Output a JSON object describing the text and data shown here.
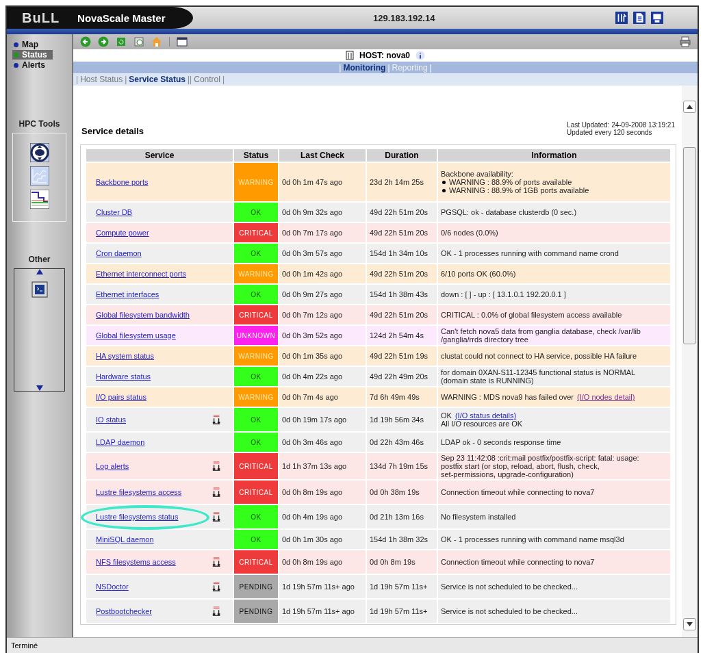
{
  "titlebar": {
    "logo": "BuLL",
    "app": "NovaScale Master",
    "address": "129.183.192.14"
  },
  "nav": [
    {
      "label": "Map",
      "selected": false
    },
    {
      "label": "Status",
      "selected": true
    },
    {
      "label": "Alerts",
      "selected": false
    }
  ],
  "sidebar": {
    "hpc_title": "HPC Tools",
    "other_title": "Other"
  },
  "host": {
    "label": "HOST: nova0"
  },
  "tabs": [
    {
      "kind": "separator",
      "label": "|"
    },
    {
      "kind": "tab",
      "label": "Monitoring",
      "selected": true
    },
    {
      "kind": "separator",
      "label": "|"
    },
    {
      "kind": "tab",
      "label": "Reporting",
      "selected": false
    },
    {
      "kind": "separator",
      "label": "|"
    }
  ],
  "subtabs": [
    {
      "kind": "separator",
      "label": "|"
    },
    {
      "kind": "tab",
      "label": "Host Status",
      "selected": false
    },
    {
      "kind": "separator",
      "label": "|"
    },
    {
      "kind": "tab",
      "label": "Service Status",
      "selected": true
    },
    {
      "kind": "separator",
      "label": "||"
    },
    {
      "kind": "tab",
      "label": "Control",
      "selected": false
    },
    {
      "kind": "separator",
      "label": "|"
    }
  ],
  "details": {
    "title": "Service details",
    "updated": "Last Updated: 24-09-2008 13:19:21",
    "interval": "Updated every 120 seconds"
  },
  "table": {
    "columns": [
      "Service",
      "Status",
      "Last Check",
      "Duration",
      "Information"
    ],
    "rows": [
      {
        "service": "Backbone ports",
        "easy": false,
        "highlighted": false,
        "kind": "warning",
        "status": "WARNING",
        "last_check": "0d 0h 1m 47s ago",
        "duration": "23d 2h 14m 25s",
        "info": [
          {
            "kind": "plain",
            "text": "Backbone availability:"
          },
          {
            "kind": "bullet",
            "text": "WARNING : 88.9% of ports available"
          },
          {
            "kind": "bullet",
            "text": "WARNING : 88.9% of 1GB ports available"
          }
        ]
      },
      {
        "service": "Cluster DB",
        "easy": false,
        "highlighted": false,
        "kind": "ok",
        "status": "OK",
        "last_check": "0d 0h 9m 32s ago",
        "duration": "49d 22h 51m 20s",
        "info": [
          {
            "kind": "plain",
            "text": "PGSQL: ok - database clusterdb (0 sec.)"
          }
        ]
      },
      {
        "service": "Compute power",
        "easy": false,
        "highlighted": false,
        "kind": "critical",
        "status": "CRITICAL",
        "last_check": "0d 0h 7m 17s ago",
        "duration": "49d 22h 51m 20s",
        "info": [
          {
            "kind": "plain",
            "text": "0/6 nodes (0.0%)"
          }
        ]
      },
      {
        "service": "Cron daemon",
        "easy": false,
        "highlighted": false,
        "kind": "ok",
        "status": "OK",
        "last_check": "0d 0h 3m 57s ago",
        "duration": "154d 1h 34m 10s",
        "info": [
          {
            "kind": "plain",
            "text": "OK - 1 processes running with command name crond"
          }
        ]
      },
      {
        "service": "Ethernet interconnect ports",
        "easy": false,
        "highlighted": false,
        "kind": "warning",
        "status": "WARNING",
        "last_check": "0d 0h 1m 42s ago",
        "duration": "49d 22h 51m 20s",
        "info": [
          {
            "kind": "plain",
            "text": "6/10 ports OK (60.0%)"
          }
        ]
      },
      {
        "service": "Ethernet interfaces",
        "easy": false,
        "highlighted": false,
        "kind": "ok",
        "status": "OK",
        "last_check": "0d 0h 9m 27s ago",
        "duration": "154d 1h 38m 43s",
        "info": [
          {
            "kind": "plain",
            "text": "down : [ ] - up : [ 13.1.0.1 192.20.0.1 ]"
          }
        ]
      },
      {
        "service": "Global filesystem bandwidth",
        "easy": false,
        "highlighted": false,
        "kind": "critical",
        "status": "CRITICAL",
        "last_check": "0d 0h 7m 12s ago",
        "duration": "49d 22h 51m 20s",
        "info": [
          {
            "kind": "plain",
            "text": "CRITICAL : 0.0% of global filesystem access available"
          }
        ]
      },
      {
        "service": "Global filesystem usage",
        "easy": false,
        "highlighted": false,
        "kind": "unknown",
        "status": "UNKNOWN",
        "last_check": "0d 0h 3m 52s ago",
        "duration": "124d 2h 54m 4s",
        "info": [
          {
            "kind": "plain",
            "text": "Can't fetch nova5 data from ganglia database, check /var/lib"
          },
          {
            "kind": "plain",
            "text": "/ganglia/rrds directory tree"
          }
        ]
      },
      {
        "service": "HA system status",
        "easy": false,
        "highlighted": false,
        "kind": "warning",
        "status": "WARNING",
        "last_check": "0d 0h 1m 35s ago",
        "duration": "49d 22h 51m 19s",
        "info": [
          {
            "kind": "plain",
            "text": "clustat could not connect to HA service, possible HA failure"
          }
        ]
      },
      {
        "service": "Hardware status",
        "easy": false,
        "highlighted": false,
        "kind": "ok",
        "status": "OK",
        "last_check": "0d 0h 4m 22s ago",
        "duration": "49d 22h 49m 20s",
        "info": [
          {
            "kind": "plain",
            "text": "for domain 0XAN-S11-12345 functional status is NORMAL"
          },
          {
            "kind": "plain",
            "text": "(domain state is RUNNING)"
          }
        ]
      },
      {
        "service": "I/O pairs status",
        "easy": false,
        "highlighted": false,
        "kind": "warning",
        "status": "WARNING",
        "last_check": "0d 0h 7m 4s ago",
        "duration": "7d 6h 49m 49s",
        "info": [
          {
            "kind": "plain",
            "text": "WARNING : MDS nova9 has failed over",
            "link": {
              "text": "(I/O nodes detail)",
              "visited": true
            }
          }
        ]
      },
      {
        "service": "IO status",
        "easy": true,
        "highlighted": false,
        "kind": "ok",
        "status": "OK",
        "last_check": "0d 0h 19m 17s ago",
        "duration": "1d 19h 56m 34s",
        "info": [
          {
            "kind": "plain",
            "text": "OK",
            "link": {
              "text": "(I/O status details)",
              "visited": false
            }
          },
          {
            "kind": "plain",
            "text": "All I/O resources are OK"
          }
        ]
      },
      {
        "service": "LDAP daemon",
        "easy": false,
        "highlighted": false,
        "kind": "ok",
        "status": "OK",
        "last_check": "0d 0h 3m 46s ago",
        "duration": "0d 22h 43m 46s",
        "info": [
          {
            "kind": "plain",
            "text": "LDAP ok - 0 seconds response time"
          }
        ]
      },
      {
        "service": "Log alerts",
        "easy": true,
        "highlighted": false,
        "kind": "critical",
        "status": "CRITICAL",
        "last_check": "1d 1h 37m 13s ago",
        "duration": "134d 7h 19m 15s",
        "info": [
          {
            "kind": "plain",
            "text": "Sep 23 11:42:08 :crit:mail postfix/postfix-script: fatal: usage:"
          },
          {
            "kind": "plain",
            "text": "postfix start (or stop, reload, abort, flush, check,"
          },
          {
            "kind": "plain",
            "text": "set-permissions, upgrade-configuration)"
          }
        ]
      },
      {
        "service": "Lustre filesystems access",
        "easy": true,
        "highlighted": false,
        "kind": "critical",
        "status": "CRITICAL",
        "last_check": "0d 0h 8m 19s ago",
        "duration": "0d 0h 38m 19s",
        "info": [
          {
            "kind": "plain",
            "text": "Connection timeout while connecting to nova7"
          }
        ]
      },
      {
        "service": "Lustre filesystems status",
        "easy": true,
        "highlighted": true,
        "kind": "ok",
        "status": "OK",
        "last_check": "0d 0h 4m 19s ago",
        "duration": "0d 21h 13m 16s",
        "info": [
          {
            "kind": "plain",
            "text": "No filesystem installed"
          }
        ]
      },
      {
        "service": "MiniSQL daemon",
        "easy": false,
        "highlighted": false,
        "kind": "ok",
        "status": "OK",
        "last_check": "0d 0h 1m 30s ago",
        "duration": "154d 1h 38m 32s",
        "info": [
          {
            "kind": "plain",
            "text": "OK - 1 processes running with command name msql3d"
          }
        ]
      },
      {
        "service": "NFS filesystems access",
        "easy": true,
        "highlighted": false,
        "kind": "critical",
        "status": "CRITICAL",
        "last_check": "0d 0h 8m 19s ago",
        "duration": "0d 0h 8m 19s",
        "info": [
          {
            "kind": "plain",
            "text": "Connection timeout while connecting to nova7"
          }
        ]
      },
      {
        "service": "NSDoctor",
        "easy": true,
        "highlighted": false,
        "kind": "pending",
        "status": "PENDING",
        "last_check": "1d 19h 57m 11s+ ago",
        "duration": "1d 19h 57m 11s+",
        "info": [
          {
            "kind": "plain",
            "text": "Service is not scheduled to be checked..."
          }
        ]
      },
      {
        "service": "Postbootchecker",
        "easy": true,
        "highlighted": false,
        "kind": "pending",
        "status": "PENDING",
        "last_check": "1d 19h 57m 11s+ ago",
        "duration": "1d 19h 57m 11s+",
        "info": [
          {
            "kind": "plain",
            "text": "Service is not scheduled to be checked..."
          }
        ]
      }
    ]
  },
  "status_bar": {
    "text": "Terminé"
  }
}
